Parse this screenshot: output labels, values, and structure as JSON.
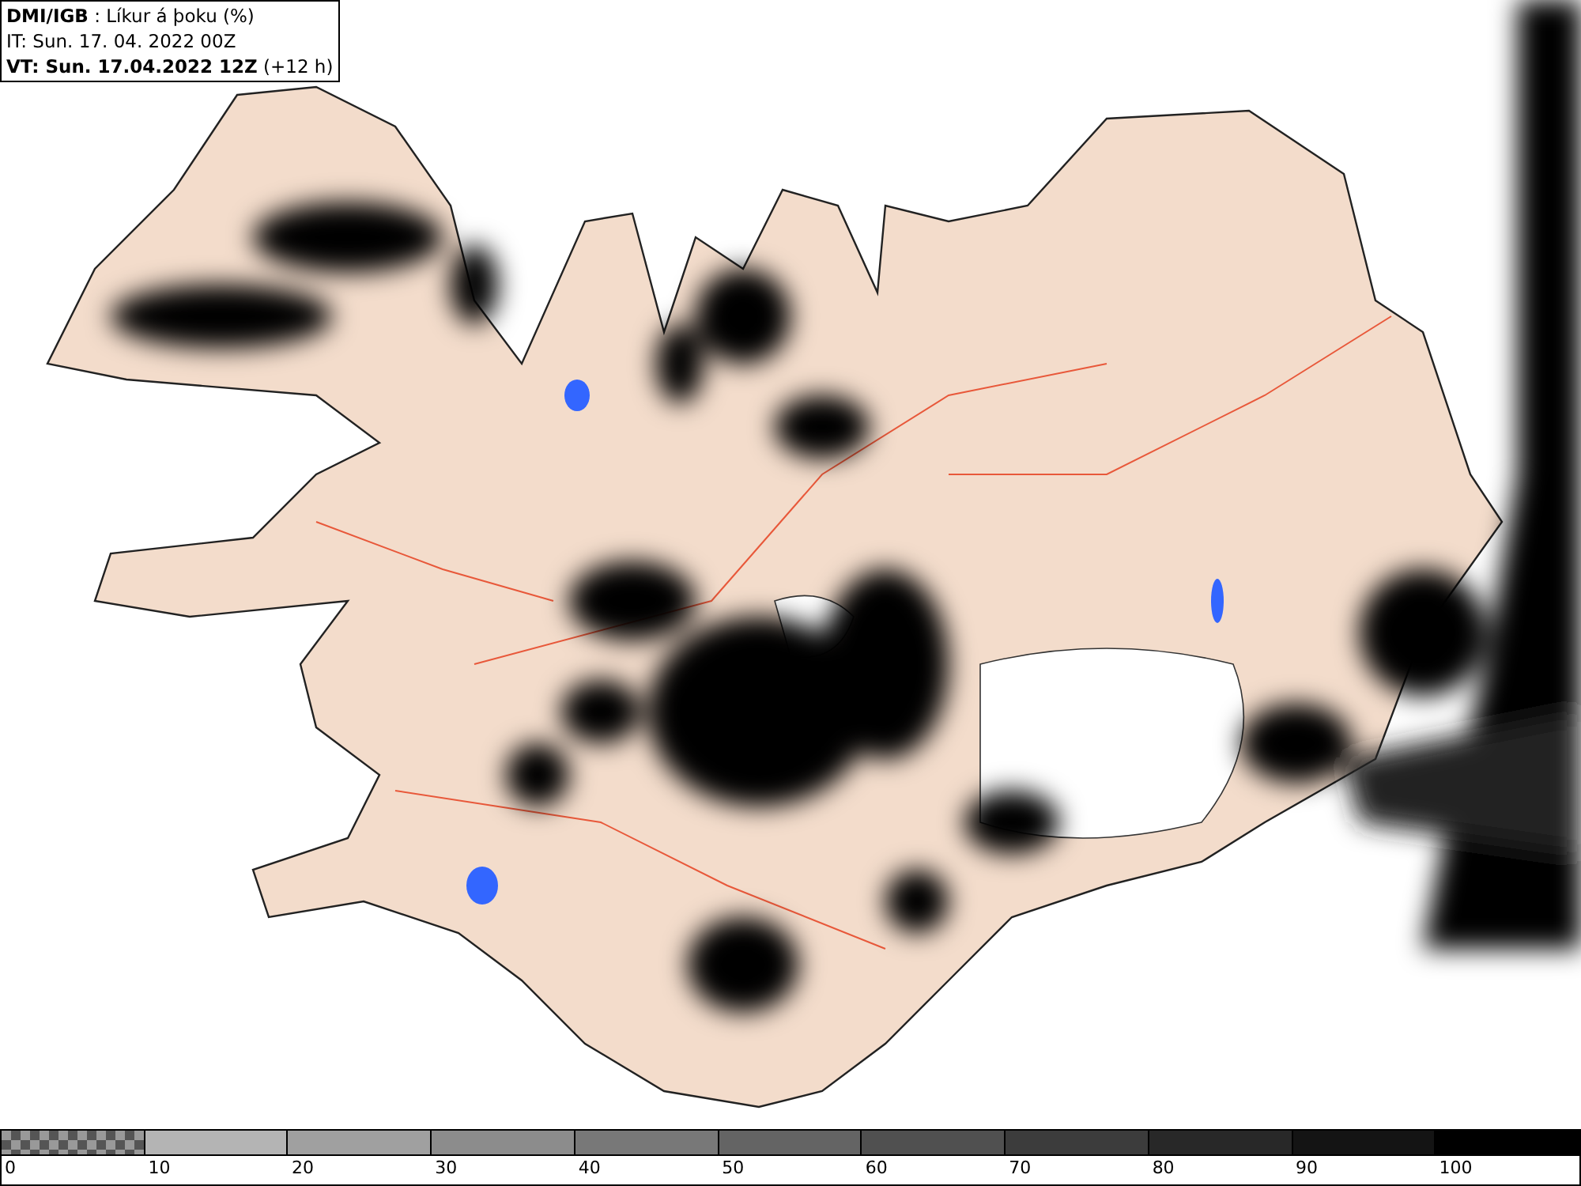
{
  "header": {
    "lines": [
      "**DMI/IGB** : Líkur á þoku (%)",
      "IT: Sun. 17. 04. 2022 00Z",
      "**VT: Sun. 17.04.2022 12Z** (+12 h)"
    ]
  },
  "legend": [
    {
      "label": "0",
      "kind": "checker"
    },
    {
      "label": "10",
      "kind": "solid",
      "color": "#b4b4b4"
    },
    {
      "label": "20",
      "kind": "solid",
      "color": "#a0a0a0"
    },
    {
      "label": "30",
      "kind": "solid",
      "color": "#8c8c8c"
    },
    {
      "label": "40",
      "kind": "solid",
      "color": "#787878"
    },
    {
      "label": "50",
      "kind": "solid",
      "color": "#646464"
    },
    {
      "label": "60",
      "kind": "solid",
      "color": "#505050"
    },
    {
      "label": "70",
      "kind": "solid",
      "color": "#3c3c3c"
    },
    {
      "label": "80",
      "kind": "solid",
      "color": "#282828"
    },
    {
      "label": "90",
      "kind": "solid",
      "color": "#141414"
    },
    {
      "label": "100",
      "kind": "solid",
      "color": "#000000"
    }
  ]
}
